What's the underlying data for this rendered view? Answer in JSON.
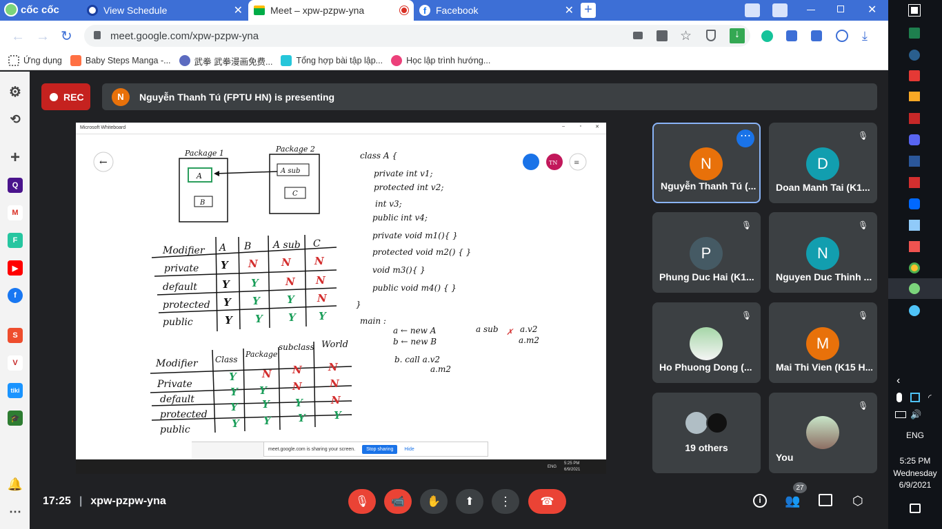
{
  "browser": {
    "brand": "cốc cốc",
    "tabs": [
      {
        "label": "View Schedule"
      },
      {
        "label": "Meet – xpw-pzpw-yna"
      },
      {
        "label": "Facebook"
      }
    ],
    "url": "meet.google.com/xpw-pzpw-yna",
    "bookmarks": [
      {
        "label": "Ứng dụng"
      },
      {
        "label": "Baby Steps Manga -..."
      },
      {
        "label": "武拳 武拳漫画免费..."
      },
      {
        "label": "Tổng hợp bài tập lập..."
      },
      {
        "label": "Học lập trình hướng..."
      }
    ]
  },
  "meet": {
    "rec_label": "REC",
    "presenter_initial": "N",
    "presenting_text": "Nguyễn Thanh Tú (FPTU HN) is presenting",
    "time": "17:25",
    "meeting_code": "xpw-pzpw-yna",
    "participants_count": "27",
    "tiles": [
      {
        "name": "Nguyễn Thanh Tú (...",
        "initial": "N",
        "color": "#e8710a"
      },
      {
        "name": "Doan Manh Tai (K1...",
        "initial": "D",
        "color": "#129eaf"
      },
      {
        "name": "Phung Duc Hai (K1...",
        "initial": "P",
        "color": "#455a64"
      },
      {
        "name": "Nguyen Duc Thinh ...",
        "initial": "N",
        "color": "#129eaf"
      },
      {
        "name": "Ho Phuong Dong (...",
        "initial": "",
        "color": "#8bc34a"
      },
      {
        "name": "Mai Thi Vien (K15 H...",
        "initial": "M",
        "color": "#e8710a"
      },
      {
        "name": "19 others",
        "initial": "",
        "color": "#5f6368"
      },
      {
        "name": "You",
        "initial": "",
        "color": "#8d6e63"
      }
    ]
  },
  "whiteboard": {
    "window_title": "Microsoft Whiteboard",
    "pkg1": "Package 1",
    "pkg2": "Package 2",
    "class_a": "A",
    "class_b": "B",
    "class_asub": "A sub",
    "class_c": "C",
    "table1_headers": [
      "Modifier",
      "A",
      "B",
      "A sub",
      "C"
    ],
    "table1_rows": [
      [
        "private",
        "Y",
        "N",
        "N",
        "N"
      ],
      [
        "default",
        "Y",
        "Y",
        "N",
        "N"
      ],
      [
        "protected",
        "Y",
        "Y",
        "Y",
        "N"
      ],
      [
        "public",
        "Y",
        "Y",
        "Y",
        "Y"
      ]
    ],
    "table2_headers": [
      "Modifier",
      "Class",
      "Package",
      "subclass",
      "World"
    ],
    "table2_rows": [
      [
        "Private",
        "Y",
        "N",
        "N",
        "N"
      ],
      [
        "default",
        "Y",
        "Y",
        "N",
        "N"
      ],
      [
        "protected",
        "Y",
        "Y",
        "Y",
        "N"
      ],
      [
        "public",
        "Y",
        "Y",
        "Y",
        "Y"
      ]
    ],
    "code": [
      "class A {",
      "private int v1;",
      "protected int v2;",
      "int v3;",
      "public int v4;",
      "private void m1(){ }",
      "protected void m2() { }",
      "void m3(){ }",
      "public void m4() { }",
      "}"
    ],
    "main_label": "main :",
    "main_lines": [
      "a ← new A",
      "b ← new B",
      "b. call  a.v2",
      "a.m2"
    ],
    "asub_lines": [
      "a sub",
      "a.v2",
      "a.m2"
    ],
    "avatar_tn": "TN",
    "sharing_text": "meet.google.com is sharing your screen.",
    "stop_sharing": "Stop sharing",
    "hide": "Hide",
    "inner_time": "5:25 PM",
    "inner_date": "6/9/2021",
    "inner_lang": "ENG"
  },
  "windows": {
    "lang": "ENG",
    "time": "5:25 PM",
    "day": "Wednesday",
    "date": "6/9/2021"
  }
}
